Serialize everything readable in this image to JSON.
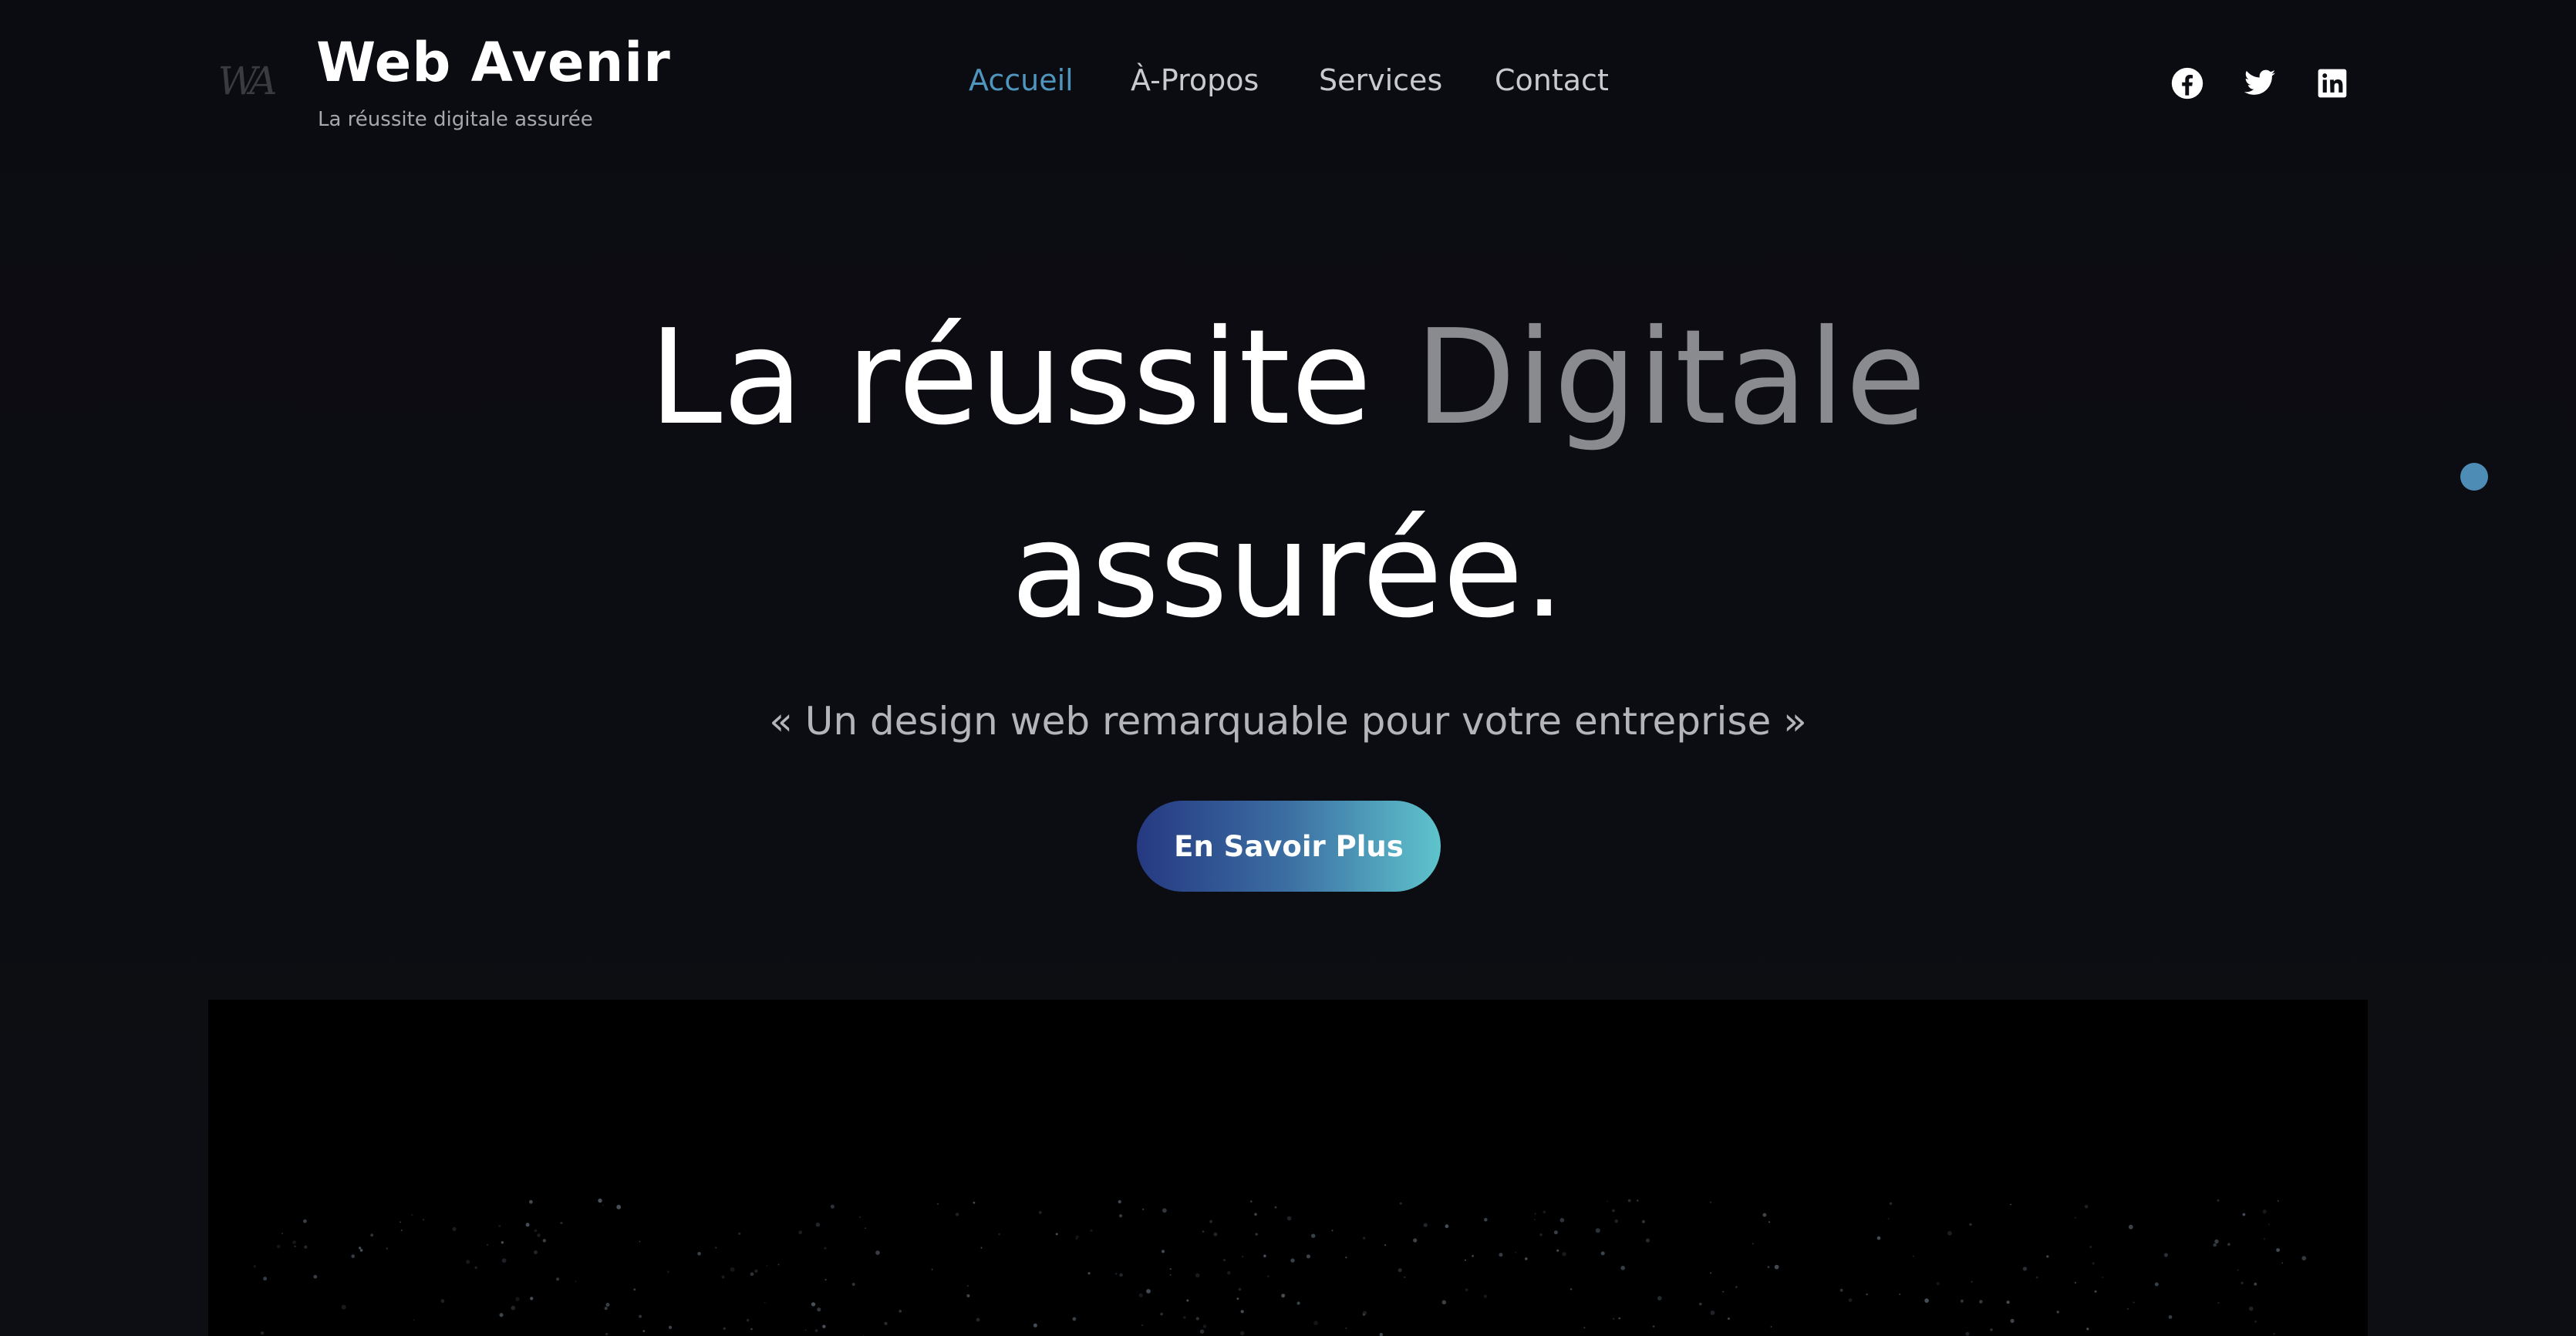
{
  "header": {
    "logo_text": "WA",
    "brand_title": "Web Avenir",
    "brand_tagline": "La réussite digitale assurée",
    "nav": [
      {
        "label": "Accueil",
        "active": true
      },
      {
        "label": "À-Propos",
        "active": false
      },
      {
        "label": "Services",
        "active": false
      },
      {
        "label": "Contact",
        "active": false
      }
    ],
    "socials": [
      {
        "icon": "facebook-icon"
      },
      {
        "icon": "twitter-icon"
      },
      {
        "icon": "linkedin-icon"
      }
    ]
  },
  "hero": {
    "title_part1": "La réussite",
    "title_part2": "Digitale",
    "title_line2": "assurée.",
    "subtitle": "« Un design web remarquable pour votre entreprise »",
    "cta_label": "En Savoir Plus"
  },
  "colors": {
    "background": "#0c0d12",
    "accent": "#4f95bd",
    "cta_gradient_start": "#253981",
    "cta_gradient_end": "#5ec4cc",
    "dim_text": "#8a8b8f"
  }
}
